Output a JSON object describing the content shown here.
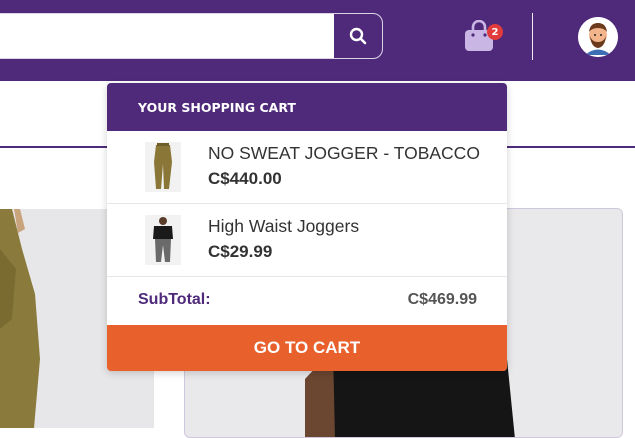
{
  "header": {
    "search_placeholder": "",
    "cart_count": "2",
    "colors": {
      "brand": "#4f2a7a",
      "badge": "#e23b3b"
    }
  },
  "cart_popup": {
    "title": "YOUR SHOPPING CART",
    "items": [
      {
        "name": "NO SWEAT JOGGER - TOBACCO",
        "price": "C$440.00"
      },
      {
        "name": "High Waist Joggers",
        "price": "C$29.99"
      }
    ],
    "subtotal_label": "SubTotal:",
    "subtotal_value": "C$469.99",
    "button_label": "GO TO CART",
    "button_color": "#e8612c"
  },
  "icons": [
    "search-icon",
    "shopping-bag-icon",
    "user-avatar-icon"
  ]
}
